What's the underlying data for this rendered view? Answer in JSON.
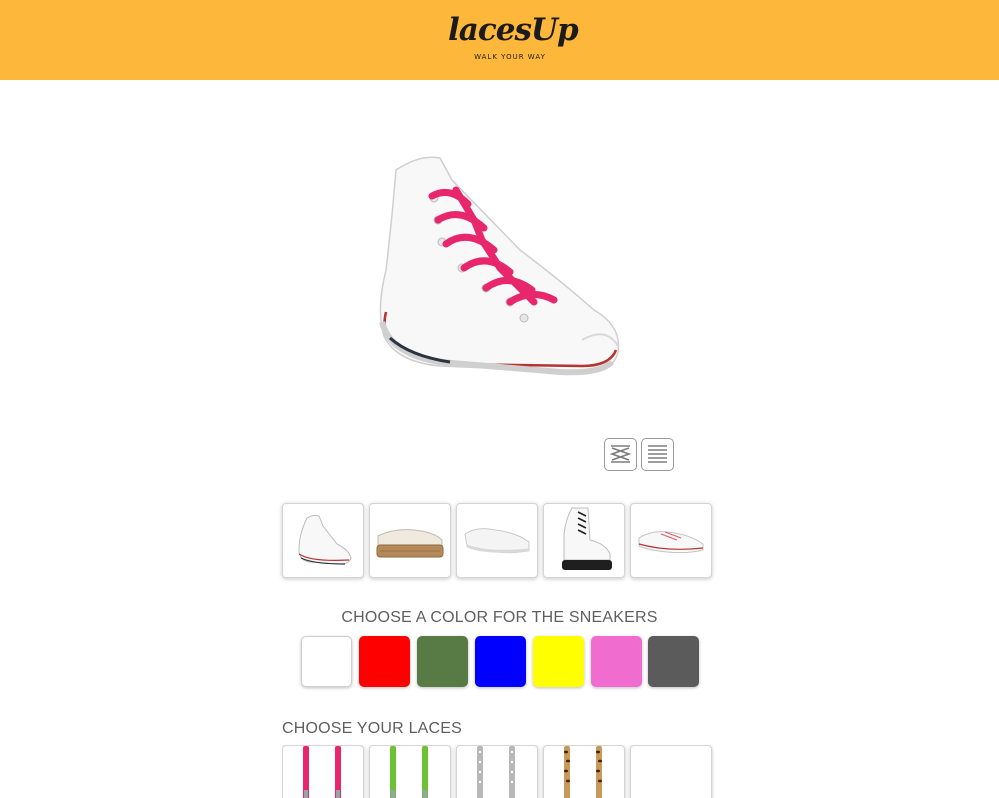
{
  "brand": {
    "name": "lacesUp",
    "tagline": "WALK YOUR WAY",
    "header_color": "#fdb73b"
  },
  "preview": {
    "image": "white-high-top-sneaker-with-pink-laces",
    "lace_color": "#e8266b"
  },
  "view_toggles": [
    {
      "icon": "criss-cross-lacing-icon"
    },
    {
      "icon": "straight-lacing-icon"
    }
  ],
  "shoe_models": [
    {
      "icon": "white-high-top-sneaker"
    },
    {
      "icon": "platform-espadrille-sneaker"
    },
    {
      "icon": "white-slip-on-sneaker"
    },
    {
      "icon": "white-leather-boot"
    },
    {
      "icon": "white-low-top-sneaker"
    }
  ],
  "sneaker_colors": {
    "title": "CHOOSE A COLOR FOR THE SNEAKERS",
    "options": [
      "#ffffff",
      "#ff0000",
      "#587a44",
      "#0000ff",
      "#ffff00",
      "#f06ccf",
      "#5b5b5b"
    ]
  },
  "laces": {
    "title": "CHOOSE YOUR LACES",
    "options": [
      {
        "icon": "pink-lace"
      },
      {
        "icon": "green-lace"
      },
      {
        "icon": "silver-dotted-lace"
      },
      {
        "icon": "leopard-print-lace"
      },
      {
        "icon": "empty-lace-slot"
      }
    ]
  }
}
